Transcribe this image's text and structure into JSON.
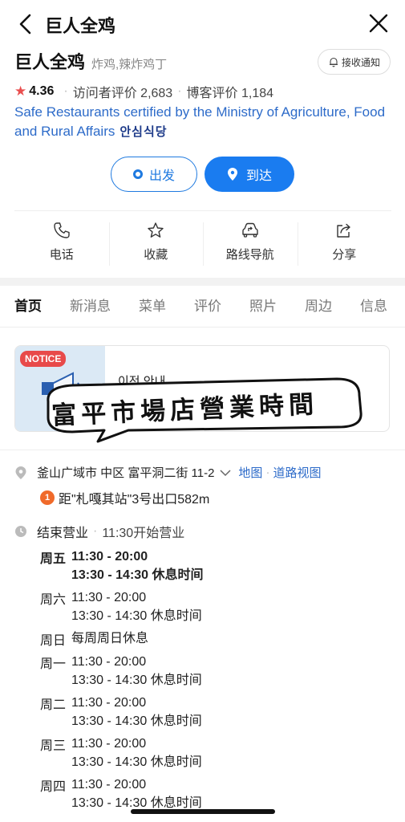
{
  "header": {
    "title": "巨人全鸡"
  },
  "place": {
    "name": "巨人全鸡",
    "category": "炸鸡,辣炸鸡丁",
    "notify_label": "接收通知",
    "rating": "4.36",
    "visitor_reviews": "访问者评价 2,683",
    "blog_reviews": "博客评价 1,184",
    "certification": "Safe Restaurants certified by the Ministry of Agriculture, Food and Rural Affairs",
    "cert_badge": "안심식당"
  },
  "directions": {
    "depart": "出发",
    "arrive": "到达"
  },
  "actions": [
    {
      "label": "电话",
      "icon": "phone-icon"
    },
    {
      "label": "收藏",
      "icon": "star-icon"
    },
    {
      "label": "路线导航",
      "icon": "route-icon"
    },
    {
      "label": "分享",
      "icon": "share-icon"
    }
  ],
  "tabs": [
    "首页",
    "新消息",
    "菜单",
    "评价",
    "照片",
    "周边",
    "信息"
  ],
  "notice": {
    "tag": "NOTICE",
    "title": "이전 안내"
  },
  "sticker": {
    "text": "富平市場店營業時間"
  },
  "address": {
    "text": "釜山广域市 中区 富平洞二街 11-2",
    "map_link": "地图",
    "road_link": "道路视图",
    "line": "1",
    "subway": "距\"札嘎其站\"3号出口582m"
  },
  "status": {
    "closed": "结束营业",
    "open_at": "11:30开始营业"
  },
  "hours": [
    {
      "day": "周五",
      "lines": [
        "11:30 - 20:00",
        "13:30 - 14:30 休息时间"
      ],
      "today": true
    },
    {
      "day": "周六",
      "lines": [
        "11:30 - 20:00",
        "13:30 - 14:30 休息时间"
      ]
    },
    {
      "day": "周日",
      "lines": [
        "每周周日休息"
      ]
    },
    {
      "day": "周一",
      "lines": [
        "11:30 - 20:00",
        "13:30 - 14:30 休息时间"
      ]
    },
    {
      "day": "周二",
      "lines": [
        "11:30 - 20:00",
        "13:30 - 14:30 休息时间"
      ]
    },
    {
      "day": "周三",
      "lines": [
        "11:30 - 20:00",
        "13:30 - 14:30 休息时间"
      ]
    },
    {
      "day": "周四",
      "lines": [
        "11:30 - 20:00",
        "13:30 - 14:30 休息时间"
      ]
    }
  ],
  "colors": {
    "accent": "#1a7cf0",
    "link": "#2d6bc9",
    "star": "#e94f4f",
    "notice": "#e84a4a",
    "subway_line1": "#f06a2a"
  }
}
